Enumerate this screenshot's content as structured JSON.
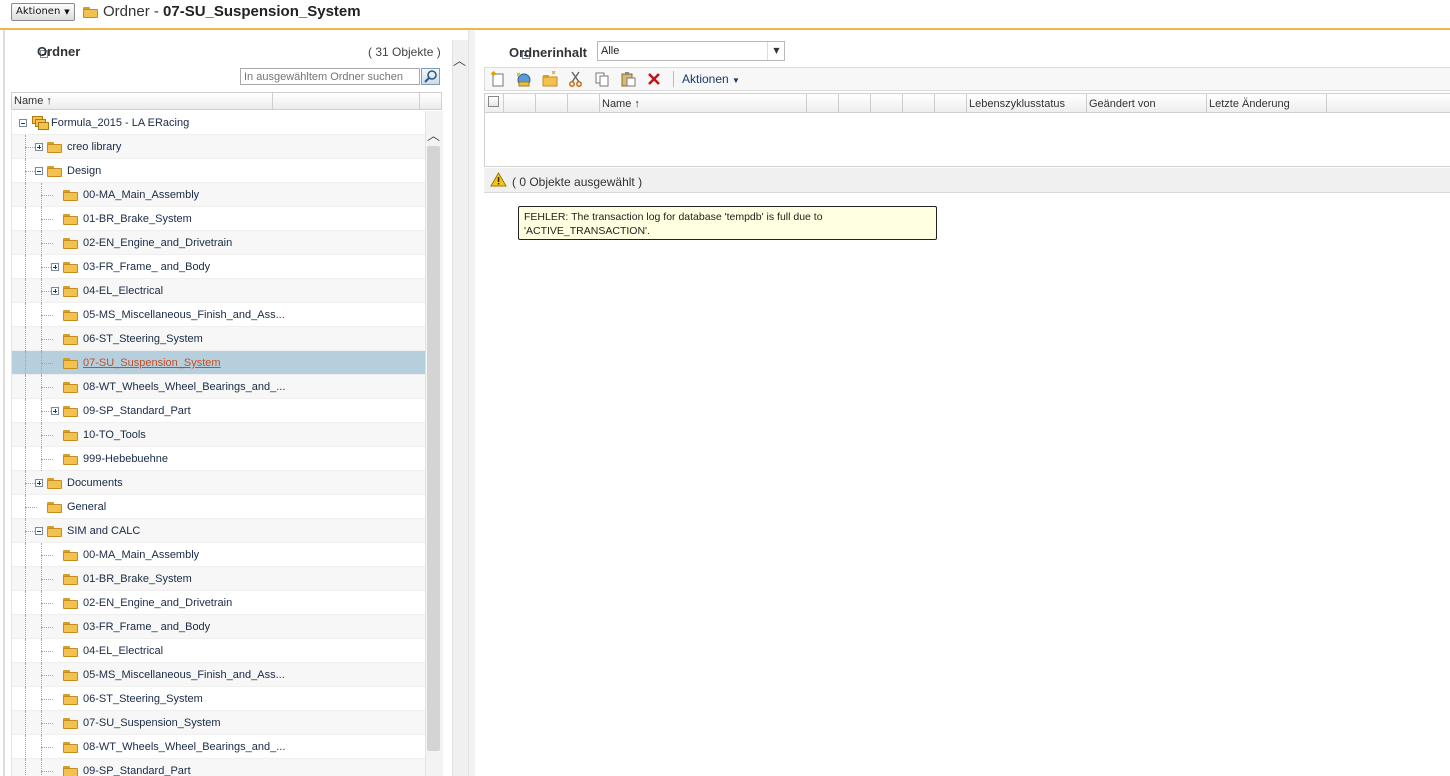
{
  "header": {
    "actions_label": "Aktionen",
    "title_prefix": "Ordner - ",
    "title_folder": "07-SU_Suspension_System"
  },
  "folder_panel": {
    "title": "Ordner",
    "count": "( 31 Objekte )",
    "search_placeholder": "In ausgewähltem Ordner suchen",
    "column_name": "Name ↑",
    "items": [
      {
        "label": "Formula_2015 - LA ERacing",
        "level": 0,
        "toggle": "collapse",
        "root": true
      },
      {
        "label": "creo library",
        "level": 1,
        "toggle": "expand"
      },
      {
        "label": "Design",
        "level": 1,
        "toggle": "collapse"
      },
      {
        "label": "00-MA_Main_Assembly",
        "level": 2,
        "toggle": "none"
      },
      {
        "label": "01-BR_Brake_System",
        "level": 2,
        "toggle": "none"
      },
      {
        "label": "02-EN_Engine_and_Drivetrain",
        "level": 2,
        "toggle": "none"
      },
      {
        "label": "03-FR_Frame_ and_Body",
        "level": 2,
        "toggle": "expand"
      },
      {
        "label": "04-EL_Electrical",
        "level": 2,
        "toggle": "expand"
      },
      {
        "label": "05-MS_Miscellaneous_Finish_and_Ass...",
        "level": 2,
        "toggle": "none"
      },
      {
        "label": "06-ST_Steering_System",
        "level": 2,
        "toggle": "none"
      },
      {
        "label": "07-SU_Suspension_System",
        "level": 2,
        "toggle": "none",
        "selected": true
      },
      {
        "label": "08-WT_Wheels_Wheel_Bearings_and_...",
        "level": 2,
        "toggle": "none"
      },
      {
        "label": "09-SP_Standard_Part",
        "level": 2,
        "toggle": "expand"
      },
      {
        "label": "10-TO_Tools",
        "level": 2,
        "toggle": "none"
      },
      {
        "label": "999-Hebebuehne",
        "level": 2,
        "toggle": "none"
      },
      {
        "label": "Documents",
        "level": 1,
        "toggle": "expand"
      },
      {
        "label": "General",
        "level": 1,
        "toggle": "none"
      },
      {
        "label": "SIM and CALC",
        "level": 1,
        "toggle": "collapse"
      },
      {
        "label": "00-MA_Main_Assembly",
        "level": 2,
        "toggle": "none"
      },
      {
        "label": "01-BR_Brake_System",
        "level": 2,
        "toggle": "none"
      },
      {
        "label": "02-EN_Engine_and_Drivetrain",
        "level": 2,
        "toggle": "none"
      },
      {
        "label": "03-FR_Frame_ and_Body",
        "level": 2,
        "toggle": "none"
      },
      {
        "label": "04-EL_Electrical",
        "level": 2,
        "toggle": "none"
      },
      {
        "label": "05-MS_Miscellaneous_Finish_and_Ass...",
        "level": 2,
        "toggle": "none"
      },
      {
        "label": "06-ST_Steering_System",
        "level": 2,
        "toggle": "none"
      },
      {
        "label": "07-SU_Suspension_System",
        "level": 2,
        "toggle": "none"
      },
      {
        "label": "08-WT_Wheels_Wheel_Bearings_and_...",
        "level": 2,
        "toggle": "none"
      },
      {
        "label": "09-SP_Standard_Part",
        "level": 2,
        "toggle": "none"
      }
    ]
  },
  "content_panel": {
    "title": "Ordnerinhalt",
    "filter_value": "Alle",
    "toolbar": {
      "icons": [
        "new-document-icon",
        "new-link-icon",
        "new-folder-icon",
        "cut-icon",
        "copy-icon",
        "paste-icon",
        "delete-icon"
      ],
      "actions_label": "Aktionen"
    },
    "columns": {
      "name": "Name ↑",
      "lifecycle": "Lebenszyklusstatus",
      "modified_by": "Geändert von",
      "last_modified": "Letzte Änderung"
    },
    "status_text": "( 0 Objekte ausgewählt )",
    "error_message": "FEHLER: The transaction log for database 'tempdb' is full due to 'ACTIVE_TRANSACTION'."
  },
  "colors": {
    "accent_border": "#f0b54a",
    "selected_row": "#b6cfdd",
    "selected_text": "#c0502a",
    "tooltip_bg": "#ffffe1"
  }
}
